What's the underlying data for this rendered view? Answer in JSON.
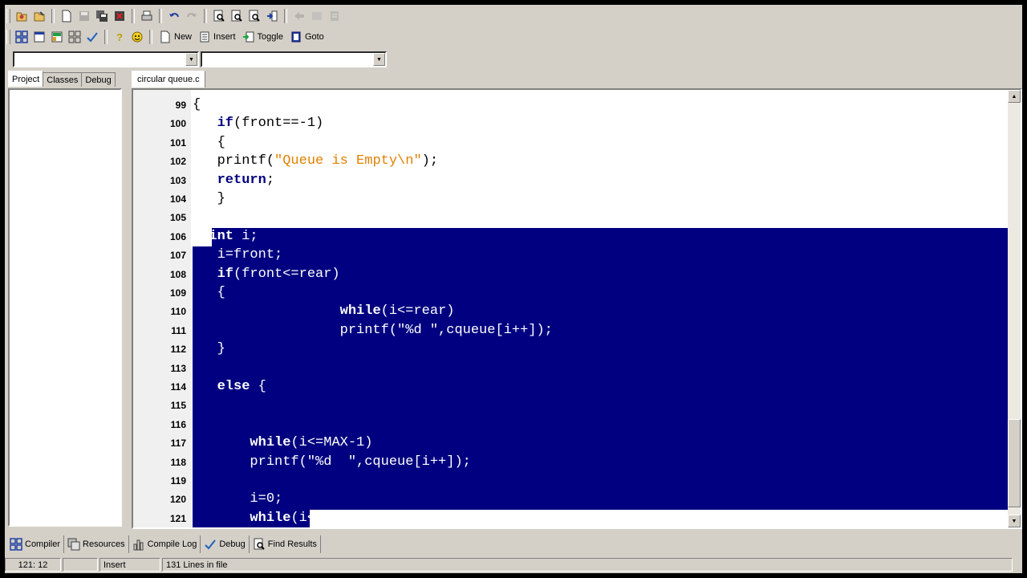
{
  "toolbar2": {
    "new_label": "New",
    "insert_label": "Insert",
    "toggle_label": "Toggle",
    "goto_label": "Goto"
  },
  "left_tabs": [
    "Project",
    "Classes",
    "Debug"
  ],
  "editor": {
    "tab_label": "circular queue.c",
    "lines": [
      {
        "num": "99",
        "html": "{"
      },
      {
        "num": "100",
        "html": "   <span class=\"kw\">if</span>(front==-1)"
      },
      {
        "num": "101",
        "html": "   {"
      },
      {
        "num": "102",
        "html": "   printf(<span class=\"str\">\"Queue is Empty\\n\"</span>);"
      },
      {
        "num": "103",
        "html": "   <span class=\"kw\">return</span>;"
      },
      {
        "num": "104",
        "html": "   }"
      },
      {
        "num": "105",
        "html": ""
      },
      {
        "num": "106",
        "html": "  <span class=\"kw\">int</span> i;"
      },
      {
        "num": "107",
        "html": "   i=front;"
      },
      {
        "num": "108",
        "html": "   <span class=\"kw\">if</span>(front&lt;=rear)"
      },
      {
        "num": "109",
        "html": "   {"
      },
      {
        "num": "110",
        "html": "                  <span class=\"kw\">while</span>(i&lt;=rear)"
      },
      {
        "num": "111",
        "html": "                  printf(\"%d \",cqueue[i++]);"
      },
      {
        "num": "112",
        "html": "   }"
      },
      {
        "num": "113",
        "html": ""
      },
      {
        "num": "114",
        "html": "   <span class=\"kw\">else</span> {"
      },
      {
        "num": "115",
        "html": ""
      },
      {
        "num": "116",
        "html": ""
      },
      {
        "num": "117",
        "html": "       <span class=\"kw\">while</span>(i&lt;=MAX-1)"
      },
      {
        "num": "118",
        "html": "       printf(\"%d  \",cqueue[i++]);"
      },
      {
        "num": "119",
        "html": ""
      },
      {
        "num": "120",
        "html": "       i=0;"
      },
      {
        "num": "121",
        "html": "       <span class=\"kw\">while</span>(i&lt;=rear)"
      }
    ],
    "selection_start_line": 106,
    "selection_end_line": 121
  },
  "bottom_tabs": [
    "Compiler",
    "Resources",
    "Compile Log",
    "Debug",
    "Find Results"
  ],
  "status": {
    "position": "121: 12",
    "mode": "Insert",
    "lines_info": "131 Lines in file"
  }
}
